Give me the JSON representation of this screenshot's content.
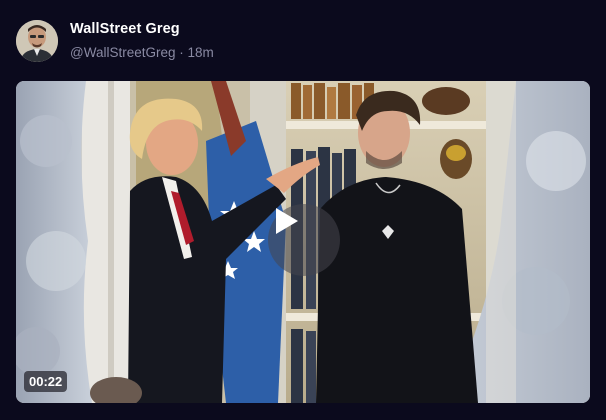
{
  "post": {
    "author_name": "WallStreet Greg",
    "author_handle": "@WallStreetGreg",
    "separator": "·",
    "time_ago": "18m",
    "video": {
      "duration": "00:22",
      "play_icon": "play-icon"
    }
  },
  "colors": {
    "background": "#0b0a1d",
    "muted_text": "#8a8aa3"
  }
}
